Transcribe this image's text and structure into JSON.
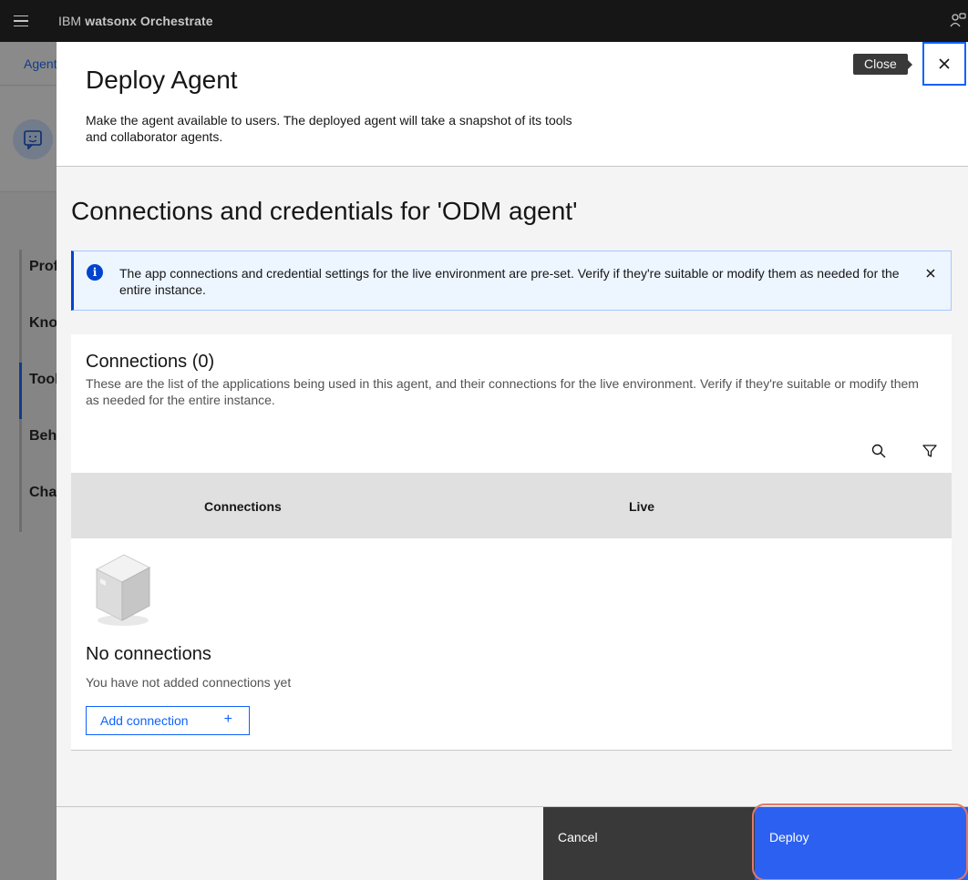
{
  "header": {
    "brand_prefix": "IBM",
    "brand_name": "watsonx Orchestrate"
  },
  "background": {
    "breadcrumb": "Agent",
    "nav_items": [
      "Prof",
      "Kno",
      "Tool",
      "Beh",
      "Cha"
    ]
  },
  "panel": {
    "title": "Deploy Agent",
    "description": "Make the agent available to users. The deployed agent will take a snapshot of its tools and collaborator agents.",
    "close_tooltip": "Close",
    "section_title": "Connections and credentials for 'ODM agent'",
    "notification": {
      "icon": "info-icon",
      "text": "The app connections and credential settings for the live environment are pre-set. Verify if they're suitable or modify them as needed for the entire instance."
    },
    "connections": {
      "title": "Connections (0)",
      "description": "These are the list of the applications being used in this agent, and their connections for the live environment. Verify if they're suitable or modify them as needed for the entire instance.",
      "columns": [
        "Connections",
        "Live"
      ],
      "empty_title": "No connections",
      "empty_description": "You have not added connections yet",
      "add_label": "Add connection",
      "add_icon": "+"
    },
    "footer": {
      "cancel_label": "Cancel",
      "deploy_label": "Deploy"
    }
  },
  "colors": {
    "primary": "#0f62fe",
    "deploy": "#2c60f0",
    "header_bg": "#161616",
    "highlight_ring": "#e07a6e"
  }
}
